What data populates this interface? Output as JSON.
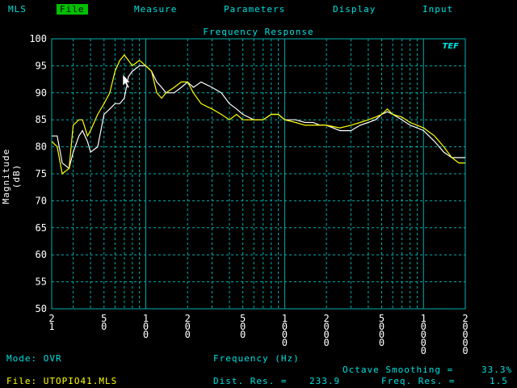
{
  "menu": {
    "items": [
      {
        "label": "MLS",
        "active": false
      },
      {
        "label": "File",
        "active": true
      },
      {
        "label": "Measure",
        "active": false
      },
      {
        "label": "Parameters",
        "active": false
      },
      {
        "label": "Display",
        "active": false
      },
      {
        "label": "Input",
        "active": false
      }
    ]
  },
  "chart_data": {
    "type": "line",
    "title": "Frequency Response",
    "xlabel": "Frequency (Hz)",
    "ylabel": "Magnitude (dB)",
    "xscale": "log",
    "xlim": [
      21,
      20000
    ],
    "ylim": [
      50,
      100
    ],
    "yticks": [
      50,
      55,
      60,
      65,
      70,
      75,
      80,
      85,
      90,
      95,
      100
    ],
    "xtick_labels": [
      "21",
      "50",
      "100",
      "200",
      "500",
      "1000",
      "2000",
      "5000",
      "10000",
      "20000"
    ],
    "grid": true,
    "series": [
      {
        "color": "#ffffff",
        "x": [
          21,
          23,
          25,
          28,
          30,
          33,
          35,
          38,
          40,
          45,
          50,
          55,
          60,
          65,
          70,
          75,
          80,
          90,
          100,
          110,
          120,
          130,
          140,
          160,
          180,
          200,
          220,
          250,
          300,
          350,
          400,
          450,
          500,
          600,
          700,
          800,
          900,
          1000,
          1200,
          1400,
          1600,
          1800,
          2000,
          2500,
          3000,
          3500,
          4000,
          4500,
          5000,
          5500,
          6000,
          7000,
          8000,
          9000,
          10000,
          12000,
          14000,
          16000,
          18000,
          20000
        ],
        "y": [
          82,
          82,
          77,
          76,
          79,
          82,
          83,
          81,
          79,
          80,
          86,
          87,
          88,
          88,
          89,
          93,
          94,
          95,
          95,
          94,
          92,
          91,
          90,
          90,
          91,
          92,
          91,
          92,
          91,
          90,
          88,
          87,
          86,
          85,
          85,
          86,
          86,
          85,
          85,
          84.5,
          84.5,
          84,
          84,
          83,
          83,
          84,
          84.5,
          85,
          86,
          86.5,
          86,
          85,
          84,
          83.5,
          83,
          81,
          79,
          78,
          78,
          78
        ]
      },
      {
        "color": "#ffff00",
        "x": [
          21,
          23,
          25,
          28,
          30,
          33,
          35,
          38,
          40,
          45,
          50,
          55,
          60,
          65,
          70,
          75,
          80,
          90,
          100,
          110,
          120,
          130,
          140,
          160,
          180,
          200,
          220,
          250,
          300,
          350,
          400,
          450,
          500,
          600,
          700,
          800,
          900,
          1000,
          1200,
          1400,
          1600,
          1800,
          2000,
          2500,
          3000,
          3500,
          4000,
          4500,
          5000,
          5500,
          6000,
          7000,
          8000,
          9000,
          10000,
          12000,
          14000,
          16000,
          18000,
          20000
        ],
        "y": [
          81,
          80,
          75,
          76,
          84,
          85,
          85,
          82,
          83,
          86,
          88,
          90,
          94,
          96,
          97,
          96,
          95,
          96,
          95,
          94,
          90,
          89,
          90,
          91,
          92,
          92,
          90,
          88,
          87,
          86,
          85,
          86,
          85,
          85,
          85,
          86,
          86,
          85,
          84.5,
          84,
          84,
          84,
          84,
          83.5,
          84,
          84.5,
          85,
          85.5,
          86,
          87,
          86,
          85.5,
          84.5,
          84,
          83.5,
          82,
          80,
          78,
          77,
          77
        ]
      }
    ]
  },
  "mode": {
    "label": "Mode:",
    "value": "OVR"
  },
  "file": {
    "label": "File:",
    "value": "UTOPIO41.MLS"
  },
  "xaxis_title": "Frequency (Hz)",
  "octave": {
    "label": "Octave Smoothing =",
    "value": "33.3%"
  },
  "dist": {
    "label": "Dist. Res. =",
    "value": "233.9"
  },
  "freq": {
    "label": "Freq. Res. =",
    "value": "1.5"
  },
  "logo": "TEF"
}
